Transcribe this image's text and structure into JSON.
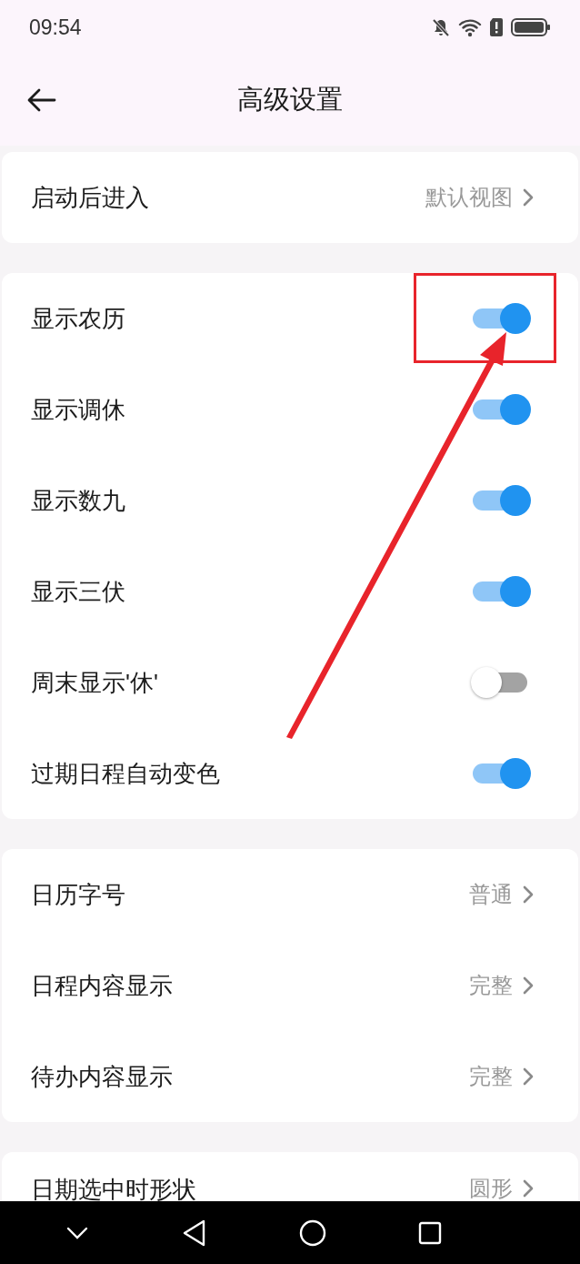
{
  "status_bar": {
    "time": "09:54"
  },
  "header": {
    "title": "高级设置"
  },
  "sections": [
    {
      "rows": [
        {
          "kind": "link",
          "label": "启动后进入",
          "value": "默认视图"
        }
      ]
    },
    {
      "rows": [
        {
          "kind": "toggle",
          "label": "显示农历",
          "on": true,
          "highlighted": true
        },
        {
          "kind": "toggle",
          "label": "显示调休",
          "on": true
        },
        {
          "kind": "toggle",
          "label": "显示数九",
          "on": true
        },
        {
          "kind": "toggle",
          "label": "显示三伏",
          "on": true
        },
        {
          "kind": "toggle",
          "label": "周末显示'休'",
          "on": false
        },
        {
          "kind": "toggle",
          "label": "过期日程自动变色",
          "on": true
        }
      ]
    },
    {
      "rows": [
        {
          "kind": "link",
          "label": "日历字号",
          "value": "普通"
        },
        {
          "kind": "link",
          "label": "日程内容显示",
          "value": "完整"
        },
        {
          "kind": "link",
          "label": "待办内容显示",
          "value": "完整"
        }
      ]
    },
    {
      "rows": [
        {
          "kind": "link",
          "label": "日期选中时形状",
          "value": "圆形"
        }
      ]
    }
  ]
}
